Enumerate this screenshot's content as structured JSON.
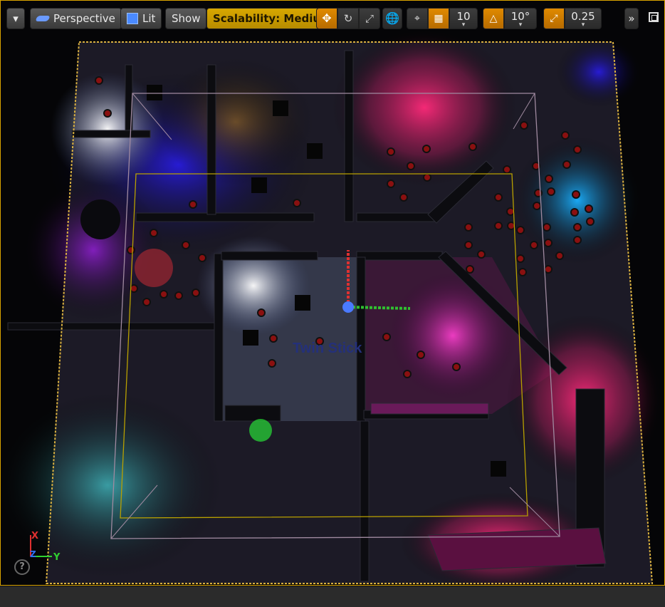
{
  "toolbar": {
    "viewport_menu_label": "▾",
    "view_mode_label": "Perspective",
    "lighting_mode_label": "Lit",
    "show_label": "Show",
    "scalability_label": "Scalability: Medium",
    "grid_snap_value": "10",
    "rotation_snap_value": "10°",
    "scale_snap_value": "0.25",
    "overflow_label": "»"
  },
  "viewport": {
    "world_text": "Twin Stick",
    "axis_labels": {
      "x": "X",
      "y": "Y",
      "z": "Z"
    }
  },
  "colors": {
    "selection_outline": "#d9a300",
    "scalability_button": "#c89b00",
    "snap_active": "#e08a00",
    "axis_x": "#e03030",
    "axis_y": "#30d030",
    "axis_z": "#3070ff"
  },
  "icons": [
    "dropdown-icon",
    "perspective-icon",
    "lit-cube-icon",
    "translate-icon",
    "rotate-icon",
    "scale-icon",
    "world-local-icon",
    "surface-snap-icon",
    "grid-snap-icon",
    "rotation-snap-icon",
    "scale-snap-icon",
    "maximize-icon",
    "help-icon"
  ]
}
